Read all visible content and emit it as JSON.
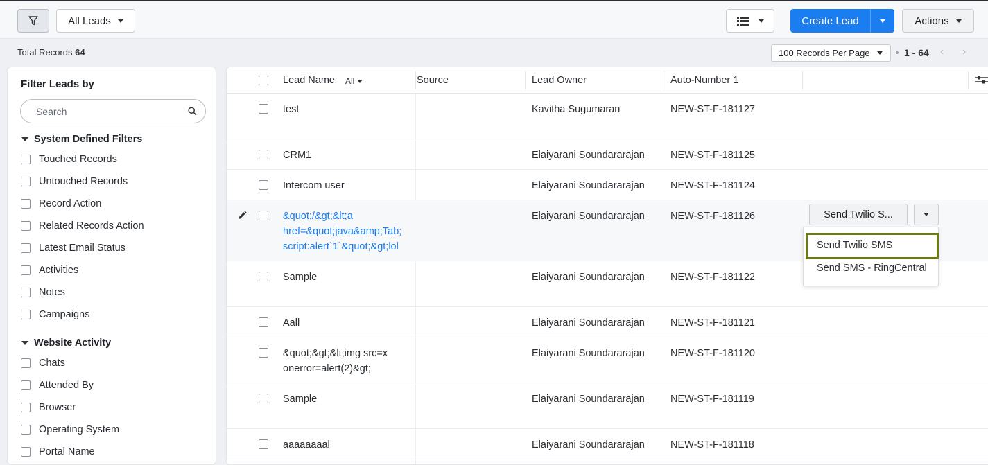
{
  "toolbar": {
    "view_selector": "All Leads",
    "create_label": "Create Lead",
    "actions_label": "Actions"
  },
  "records": {
    "total_label": "Total Records",
    "total_count": "64",
    "per_page": "100 Records Per Page",
    "range": "1 - 64"
  },
  "sidebar": {
    "title": "Filter Leads by",
    "search_placeholder": "Search",
    "sections": [
      {
        "title": "System Defined Filters",
        "items": [
          "Touched Records",
          "Untouched Records",
          "Record Action",
          "Related Records Action",
          "Latest Email Status",
          "Activities",
          "Notes",
          "Campaigns"
        ]
      },
      {
        "title": "Website Activity",
        "items": [
          "Chats",
          "Attended By",
          "Browser",
          "Operating System",
          "Portal Name"
        ]
      }
    ]
  },
  "grid": {
    "columns": {
      "lead_name": "Lead Name",
      "lead_name_filter": "All",
      "source": "Source",
      "lead_owner": "Lead Owner",
      "auto_number": "Auto-Number 1"
    },
    "rows": [
      {
        "name": "test",
        "owner": "Kavitha Sugumaran",
        "auto": "NEW-ST-F-181127"
      },
      {
        "name": "CRM1",
        "owner": "Elaiyarani Soundararajan",
        "auto": "NEW-ST-F-181125"
      },
      {
        "name": "Intercom user",
        "owner": "Elaiyarani Soundararajan",
        "auto": "NEW-ST-F-181124"
      },
      {
        "name_lines": [
          "&quot;/&gt;&lt;a",
          "href=&quot;java&amp;Tab;",
          "script:alert`1`&quot;&gt;lol"
        ],
        "owner": "Elaiyarani Soundararajan",
        "auto": "NEW-ST-F-181126"
      },
      {
        "name": "Sample",
        "owner": "Elaiyarani Soundararajan",
        "auto": "NEW-ST-F-181122"
      },
      {
        "name": "Aall",
        "owner": "Elaiyarani Soundararajan",
        "auto": "NEW-ST-F-181121"
      },
      {
        "name_lines": [
          "&quot;&gt;&lt;img src=x",
          "onerror=alert(2)&gt;"
        ],
        "owner": "Elaiyarani Soundararajan",
        "auto": "NEW-ST-F-181120"
      },
      {
        "name": "Sample",
        "owner": "Elaiyarani Soundararajan",
        "auto": "NEW-ST-F-181119"
      },
      {
        "name": "aaaaaaaal",
        "owner": "Elaiyarani Soundararajan",
        "auto": "NEW-ST-F-181118"
      }
    ]
  },
  "row_action": {
    "button_label": "Send Twilio S...",
    "menu": [
      "Send Twilio SMS",
      "Send SMS - RingCentral"
    ]
  }
}
